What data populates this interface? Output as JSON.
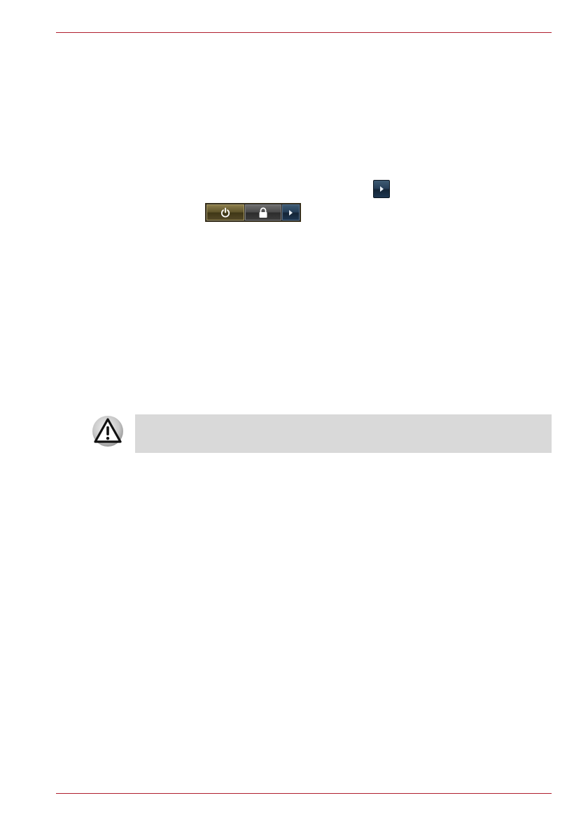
{
  "page": {
    "accent_color": "#b01e2e",
    "note_background": "#d9d9d9"
  },
  "icons": {
    "inline_arrow": "right-arrow-icon",
    "power": "power-icon",
    "lock": "lock-icon",
    "menu_arrow": "right-arrow-icon",
    "warning": "warning-triangle-icon"
  },
  "warning_note": {
    "text": ""
  }
}
